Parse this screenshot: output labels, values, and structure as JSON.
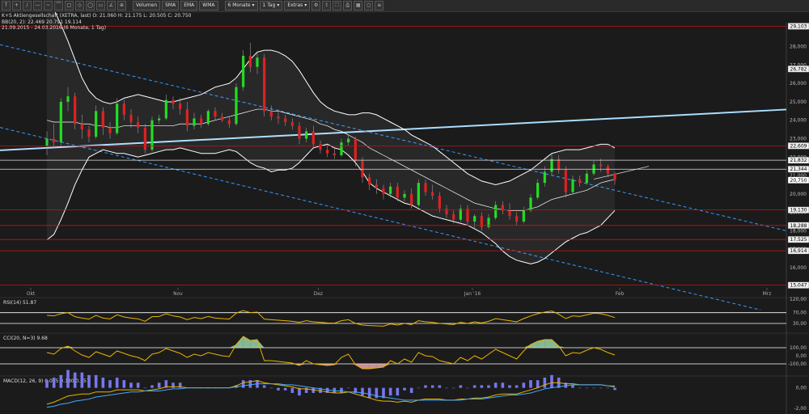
{
  "toolbar": {
    "tool_icons": [
      "T",
      "+",
      "/",
      "—",
      "~",
      "⌒",
      "□",
      "◇",
      "◯",
      "▭",
      "∠",
      "⊕"
    ],
    "indicators": [
      "Volumen",
      "SMA",
      "EMA",
      "WMA"
    ],
    "period": "6 Monate",
    "interval": "1 Tag",
    "extras": "Extras"
  },
  "info": {
    "line1": "K+S Aktiengesellschaft (XETRA, last)  O: 21.060  H: 21.175  L: 20.505  C: 20.750",
    "line2": "BB(20, 2): 22.469  20.791  19.114",
    "line3": "21.09.2015 - 24.03.2016 (6 Monate, 1 Tag)"
  },
  "colors": {
    "background": "#1b1b1b",
    "up_candle": "#22dd22",
    "down_candle": "#dd2222",
    "bollinger": "#ffffff",
    "trend_light": "#aaddff",
    "trend_dashed": "#3399ff",
    "hline_red": "#cc1111",
    "oscillator": "#e8b400",
    "macd_hist": "#7777ee"
  },
  "chart_data": [
    {
      "type": "candlestick",
      "title": "K+S Aktiengesellschaft (XETRA, last)",
      "ylim": [
        14.9,
        29.3
      ],
      "y_ticks": [
        16.0,
        17.0,
        18.0,
        19.0,
        20.0,
        21.0,
        22.0,
        23.0,
        24.0,
        25.0,
        26.0,
        27.0,
        28.0
      ],
      "x_tick_labels": [
        "Okt",
        "Nov",
        "Dez",
        "Jan '16",
        "Feb",
        "Mrz"
      ],
      "price_labels": [
        29.103,
        26.782,
        22.609,
        21.832,
        21.344,
        20.75,
        19.13,
        18.288,
        17.525,
        16.914,
        15.047
      ],
      "current_price": 20.75,
      "ohlc": [
        [
          22.6,
          23.4,
          22.1,
          23.0
        ],
        [
          23.0,
          23.8,
          22.5,
          22.8
        ],
        [
          22.8,
          25.2,
          22.6,
          25.0
        ],
        [
          25.0,
          25.8,
          24.5,
          25.3
        ],
        [
          25.3,
          25.5,
          23.5,
          23.8
        ],
        [
          23.8,
          24.3,
          23.0,
          23.5
        ],
        [
          23.5,
          23.7,
          22.8,
          23.1
        ],
        [
          23.1,
          24.8,
          23.0,
          24.5
        ],
        [
          24.5,
          24.7,
          23.2,
          23.6
        ],
        [
          23.6,
          23.9,
          23.0,
          23.3
        ],
        [
          23.3,
          25.2,
          23.2,
          24.9
        ],
        [
          24.9,
          25.1,
          24.0,
          24.3
        ],
        [
          24.3,
          24.6,
          23.6,
          23.9
        ],
        [
          23.9,
          24.2,
          23.3,
          23.6
        ],
        [
          23.6,
          23.8,
          22.2,
          22.4
        ],
        [
          22.4,
          24.2,
          22.3,
          24.0
        ],
        [
          24.0,
          24.3,
          23.8,
          24.1
        ],
        [
          24.1,
          25.4,
          24.0,
          25.1
        ],
        [
          25.1,
          25.3,
          24.6,
          24.9
        ],
        [
          24.9,
          25.2,
          24.3,
          24.6
        ],
        [
          24.6,
          25.0,
          23.4,
          23.7
        ],
        [
          23.7,
          24.4,
          23.5,
          24.1
        ],
        [
          24.1,
          24.3,
          23.6,
          23.8
        ],
        [
          23.8,
          24.6,
          23.7,
          24.5
        ],
        [
          24.5,
          24.7,
          24.0,
          24.2
        ],
        [
          24.2,
          24.4,
          23.9,
          24.0
        ],
        [
          24.0,
          24.2,
          23.6,
          23.8
        ],
        [
          23.8,
          26.0,
          23.7,
          25.8
        ],
        [
          25.8,
          27.8,
          25.6,
          27.5
        ],
        [
          27.5,
          28.2,
          26.6,
          26.9
        ],
        [
          26.9,
          27.7,
          26.5,
          27.4
        ],
        [
          27.4,
          27.6,
          24.2,
          24.5
        ],
        [
          24.5,
          24.8,
          24.0,
          24.2
        ],
        [
          24.2,
          24.6,
          23.8,
          24.1
        ],
        [
          24.1,
          24.3,
          23.7,
          23.9
        ],
        [
          23.9,
          24.1,
          23.5,
          23.7
        ],
        [
          23.7,
          23.9,
          22.7,
          23.0
        ],
        [
          23.0,
          23.6,
          22.8,
          23.4
        ],
        [
          23.4,
          23.7,
          22.5,
          22.7
        ],
        [
          22.7,
          22.9,
          22.2,
          22.4
        ],
        [
          22.4,
          22.7,
          22.0,
          22.2
        ],
        [
          22.2,
          22.5,
          21.9,
          22.1
        ],
        [
          22.1,
          23.0,
          22.0,
          22.8
        ],
        [
          22.8,
          23.2,
          22.6,
          23.0
        ],
        [
          23.0,
          23.1,
          21.5,
          21.8
        ],
        [
          21.8,
          22.0,
          20.6,
          20.9
        ],
        [
          20.9,
          21.1,
          20.2,
          20.5
        ],
        [
          20.5,
          20.8,
          20.0,
          20.3
        ],
        [
          20.3,
          20.5,
          19.7,
          20.0
        ],
        [
          20.0,
          20.6,
          19.8,
          20.4
        ],
        [
          20.4,
          20.6,
          19.6,
          19.8
        ],
        [
          19.8,
          20.2,
          19.6,
          20.0
        ],
        [
          20.0,
          20.3,
          19.2,
          19.4
        ],
        [
          19.4,
          20.8,
          19.3,
          20.6
        ],
        [
          20.6,
          20.8,
          19.9,
          20.1
        ],
        [
          20.1,
          20.5,
          19.7,
          19.9
        ],
        [
          19.9,
          20.1,
          19.0,
          19.2
        ],
        [
          19.2,
          19.4,
          18.7,
          18.9
        ],
        [
          18.9,
          19.1,
          18.4,
          18.6
        ],
        [
          18.6,
          19.4,
          18.5,
          19.2
        ],
        [
          19.2,
          19.4,
          18.3,
          18.5
        ],
        [
          18.5,
          18.9,
          18.1,
          18.8
        ],
        [
          18.8,
          19.0,
          18.0,
          18.2
        ],
        [
          18.2,
          18.9,
          18.1,
          18.7
        ],
        [
          18.7,
          19.6,
          18.6,
          19.4
        ],
        [
          19.4,
          19.6,
          18.9,
          19.1
        ],
        [
          19.1,
          19.5,
          18.6,
          18.8
        ],
        [
          18.8,
          19.0,
          18.3,
          18.5
        ],
        [
          18.5,
          19.3,
          18.4,
          19.1
        ],
        [
          19.1,
          20.0,
          19.0,
          19.8
        ],
        [
          19.8,
          20.8,
          19.7,
          20.6
        ],
        [
          20.6,
          21.5,
          20.4,
          21.2
        ],
        [
          21.2,
          22.2,
          21.0,
          21.9
        ],
        [
          21.9,
          22.1,
          21.1,
          21.3
        ],
        [
          21.3,
          21.5,
          19.8,
          20.1
        ],
        [
          20.1,
          21.0,
          20.0,
          20.8
        ],
        [
          20.8,
          21.0,
          20.4,
          20.6
        ],
        [
          20.6,
          21.3,
          20.5,
          21.1
        ],
        [
          21.1,
          21.8,
          21.0,
          21.6
        ],
        [
          21.6,
          21.9,
          21.2,
          21.5
        ],
        [
          21.5,
          21.6,
          20.9,
          21.1
        ],
        [
          21.1,
          21.2,
          20.5,
          20.75
        ]
      ],
      "bollinger": {
        "upper": [
          30.5,
          30.0,
          29.2,
          28.3,
          27.3,
          26.3,
          25.6,
          25.2,
          25.0,
          24.9,
          25.0,
          25.2,
          25.3,
          25.4,
          25.3,
          25.2,
          25.1,
          25.0,
          25.0,
          25.1,
          25.2,
          25.3,
          25.4,
          25.6,
          25.8,
          25.9,
          26.0,
          26.3,
          26.8,
          27.3,
          27.7,
          27.8,
          27.8,
          27.7,
          27.5,
          27.2,
          26.7,
          26.1,
          25.5,
          25.0,
          24.7,
          24.5,
          24.4,
          24.3,
          24.3,
          24.4,
          24.4,
          24.3,
          24.1,
          23.9,
          23.7,
          23.5,
          23.2,
          23.0,
          22.8,
          22.6,
          22.3,
          22.0,
          21.7,
          21.4,
          21.1,
          20.9,
          20.7,
          20.6,
          20.5,
          20.6,
          20.7,
          20.9,
          21.1,
          21.3,
          21.6,
          21.9,
          22.2,
          22.3,
          22.4,
          22.4,
          22.4,
          22.5,
          22.6,
          22.7,
          22.7,
          22.5
        ],
        "middle": [
          24.0,
          23.9,
          23.9,
          23.9,
          23.9,
          23.8,
          23.8,
          23.7,
          23.7,
          23.6,
          23.6,
          23.7,
          23.7,
          23.7,
          23.7,
          23.7,
          23.7,
          23.7,
          23.7,
          23.8,
          23.8,
          23.8,
          23.8,
          23.9,
          24.0,
          24.1,
          24.2,
          24.3,
          24.4,
          24.5,
          24.6,
          24.6,
          24.5,
          24.5,
          24.4,
          24.3,
          24.2,
          24.1,
          24.0,
          23.8,
          23.7,
          23.5,
          23.4,
          23.2,
          23.0,
          22.8,
          22.5,
          22.3,
          22.1,
          21.9,
          21.7,
          21.5,
          21.3,
          21.1,
          20.9,
          20.7,
          20.5,
          20.3,
          20.1,
          19.9,
          19.7,
          19.5,
          19.4,
          19.3,
          19.2,
          19.15,
          19.1,
          19.1,
          19.1,
          19.2,
          19.3,
          19.5,
          19.7,
          19.8,
          19.9,
          20.0,
          20.1,
          20.2,
          20.4,
          20.6,
          20.7,
          20.79
        ],
        "lower": [
          17.5,
          17.8,
          18.6,
          19.5,
          20.5,
          21.3,
          22.0,
          22.2,
          22.4,
          22.3,
          22.2,
          22.2,
          22.1,
          22.0,
          22.1,
          22.2,
          22.3,
          22.4,
          22.4,
          22.5,
          22.4,
          22.3,
          22.2,
          22.2,
          22.2,
          22.3,
          22.4,
          22.3,
          22.0,
          21.7,
          21.5,
          21.4,
          21.2,
          21.3,
          21.3,
          21.4,
          21.7,
          22.1,
          22.5,
          22.6,
          22.7,
          22.5,
          22.4,
          22.1,
          21.7,
          21.2,
          20.6,
          20.3,
          20.1,
          19.9,
          19.7,
          19.5,
          19.4,
          19.2,
          19.0,
          18.8,
          18.7,
          18.6,
          18.5,
          18.4,
          18.3,
          18.1,
          17.9,
          17.6,
          17.3,
          16.9,
          16.6,
          16.4,
          16.3,
          16.2,
          16.3,
          16.5,
          16.8,
          17.1,
          17.4,
          17.6,
          17.8,
          17.9,
          18.1,
          18.3,
          18.7,
          19.1
        ]
      }
    },
    {
      "type": "line",
      "title": "RSI(14) 51.87",
      "ylim": [
        0,
        120
      ],
      "y_ticks": [
        120.0
      ],
      "y_levels": [
        70.0,
        30.0
      ],
      "values": [
        60,
        58,
        66,
        70,
        55,
        50,
        46,
        60,
        50,
        47,
        62,
        54,
        50,
        47,
        38,
        55,
        56,
        66,
        58,
        54,
        44,
        52,
        48,
        56,
        50,
        48,
        46,
        68,
        78,
        70,
        72,
        46,
        44,
        42,
        40,
        38,
        34,
        40,
        36,
        34,
        32,
        31,
        40,
        44,
        30,
        24,
        22,
        21,
        20,
        28,
        24,
        30,
        26,
        40,
        36,
        34,
        30,
        28,
        26,
        34,
        30,
        36,
        32,
        38,
        48,
        44,
        40,
        36,
        48,
        58,
        66,
        72,
        76,
        64,
        48,
        58,
        56,
        62,
        68,
        66,
        60,
        51.87
      ]
    },
    {
      "type": "line",
      "title": "CCI(20, N=3) 9.68",
      "y_ticks": [
        100.0,
        0.0,
        -100.0
      ],
      "y_levels": [
        100.0,
        -100.0
      ],
      "values": [
        40,
        20,
        90,
        120,
        60,
        10,
        -20,
        50,
        20,
        -10,
        60,
        30,
        0,
        -20,
        -60,
        20,
        40,
        90,
        60,
        30,
        -20,
        20,
        0,
        40,
        20,
        0,
        -10,
        140,
        240,
        190,
        200,
        -60,
        -60,
        -70,
        -80,
        -90,
        -120,
        -60,
        -100,
        -110,
        -120,
        -110,
        -20,
        20,
        -110,
        -160,
        -160,
        -150,
        -140,
        -60,
        -100,
        -40,
        -80,
        40,
        0,
        -10,
        -60,
        -80,
        -100,
        -20,
        -60,
        0,
        -40,
        20,
        80,
        40,
        0,
        -40,
        60,
        140,
        180,
        200,
        200,
        120,
        0,
        40,
        30,
        70,
        100,
        80,
        40,
        9.68
      ]
    },
    {
      "type": "line",
      "title": "MACD(12, 26, 9) 0.095  0.180  0.057",
      "y_ticks": [
        0.0,
        -2.0
      ],
      "series_values": {
        "macd": [
          -1.6,
          -1.4,
          -1.1,
          -0.8,
          -0.7,
          -0.6,
          -0.6,
          -0.4,
          -0.4,
          -0.4,
          -0.2,
          -0.2,
          -0.2,
          -0.2,
          -0.3,
          -0.2,
          -0.1,
          0.1,
          0.1,
          0.1,
          0.0,
          0.0,
          0.0,
          0.0,
          0.0,
          0.0,
          0.0,
          0.2,
          0.5,
          0.6,
          0.7,
          0.5,
          0.4,
          0.3,
          0.2,
          0.1,
          -0.1,
          -0.1,
          -0.2,
          -0.3,
          -0.4,
          -0.5,
          -0.5,
          -0.4,
          -0.6,
          -0.8,
          -1.0,
          -1.2,
          -1.3,
          -1.3,
          -1.4,
          -1.3,
          -1.4,
          -1.2,
          -1.1,
          -1.1,
          -1.1,
          -1.2,
          -1.2,
          -1.1,
          -1.1,
          -1.0,
          -1.0,
          -0.9,
          -0.7,
          -0.6,
          -0.6,
          -0.6,
          -0.4,
          -0.2,
          0.0,
          0.3,
          0.5,
          0.5,
          0.4,
          0.4,
          0.3,
          0.3,
          0.3,
          0.3,
          0.2,
          0.095
        ],
        "signal": [
          -1.9,
          -1.8,
          -1.6,
          -1.5,
          -1.3,
          -1.2,
          -1.1,
          -0.9,
          -0.8,
          -0.7,
          -0.6,
          -0.5,
          -0.4,
          -0.4,
          -0.3,
          -0.3,
          -0.3,
          -0.2,
          -0.1,
          -0.1,
          0.0,
          0.0,
          0.0,
          0.0,
          0.0,
          0.0,
          0.0,
          0.1,
          0.2,
          0.3,
          0.4,
          0.4,
          0.4,
          0.4,
          0.3,
          0.3,
          0.2,
          0.1,
          0.0,
          -0.1,
          -0.2,
          -0.3,
          -0.3,
          -0.4,
          -0.4,
          -0.5,
          -0.6,
          -0.8,
          -0.9,
          -1.0,
          -1.1,
          -1.2,
          -1.2,
          -1.2,
          -1.2,
          -1.2,
          -1.2,
          -1.2,
          -1.2,
          -1.2,
          -1.1,
          -1.1,
          -1.1,
          -1.0,
          -0.9,
          -0.8,
          -0.7,
          -0.7,
          -0.6,
          -0.5,
          -0.3,
          -0.1,
          0.0,
          0.1,
          0.2,
          0.3,
          0.3,
          0.3,
          0.3,
          0.3,
          0.2,
          0.18
        ]
      }
    }
  ]
}
